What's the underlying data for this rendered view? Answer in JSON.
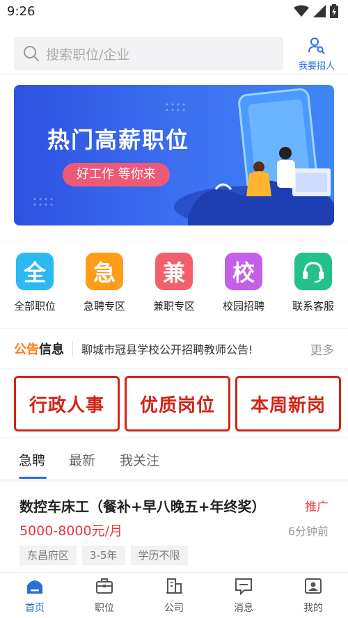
{
  "status_bar": {
    "time": "9:26"
  },
  "search": {
    "placeholder": "搜索职位/企业"
  },
  "recruit_button": {
    "label": "我要招人"
  },
  "banner": {
    "title": "热门高薪职位",
    "subtitle": "好工作 等你来"
  },
  "quick_links": [
    {
      "icon_char": "全",
      "label": "全部职位",
      "color": "#2bb9f2"
    },
    {
      "icon_char": "急",
      "label": "急聘专区",
      "color": "#ff9c18"
    },
    {
      "icon_char": "兼",
      "label": "兼职专区",
      "color": "#f2606c"
    },
    {
      "icon_char": "校",
      "label": "校园招聘",
      "color": "#c45fe8"
    },
    {
      "icon": "headset-icon",
      "label": "联系客服",
      "color": "#24c08d"
    }
  ],
  "notice": {
    "logo_part1": "公告",
    "logo_part2": "信息",
    "text": "聊城市冠县学校公开招聘教师公告!",
    "more": "更多"
  },
  "categories": [
    {
      "label": "行政人事"
    },
    {
      "label": "优质岗位"
    },
    {
      "label": "本周新岗"
    }
  ],
  "tabs": [
    {
      "label": "急聘",
      "active": true
    },
    {
      "label": "最新",
      "active": false
    },
    {
      "label": "我关注",
      "active": false
    }
  ],
  "job": {
    "title": "数控车床工（餐补+早八晚五+年终奖）",
    "promo": "推广",
    "salary": "5000-8000元/月",
    "time": "6分钟前",
    "tags": [
      "东昌府区",
      "3-5年",
      "学历不限"
    ]
  },
  "bottom_nav": [
    {
      "label": "首页",
      "icon": "home-icon",
      "active": true
    },
    {
      "label": "职位",
      "icon": "briefcase-icon",
      "active": false
    },
    {
      "label": "公司",
      "icon": "building-icon",
      "active": false
    },
    {
      "label": "消息",
      "icon": "message-icon",
      "active": false
    },
    {
      "label": "我的",
      "icon": "profile-icon",
      "active": false
    }
  ],
  "colors": {
    "accent": "#2a6fd8",
    "danger": "#d02418",
    "salary": "#e33b3b"
  }
}
